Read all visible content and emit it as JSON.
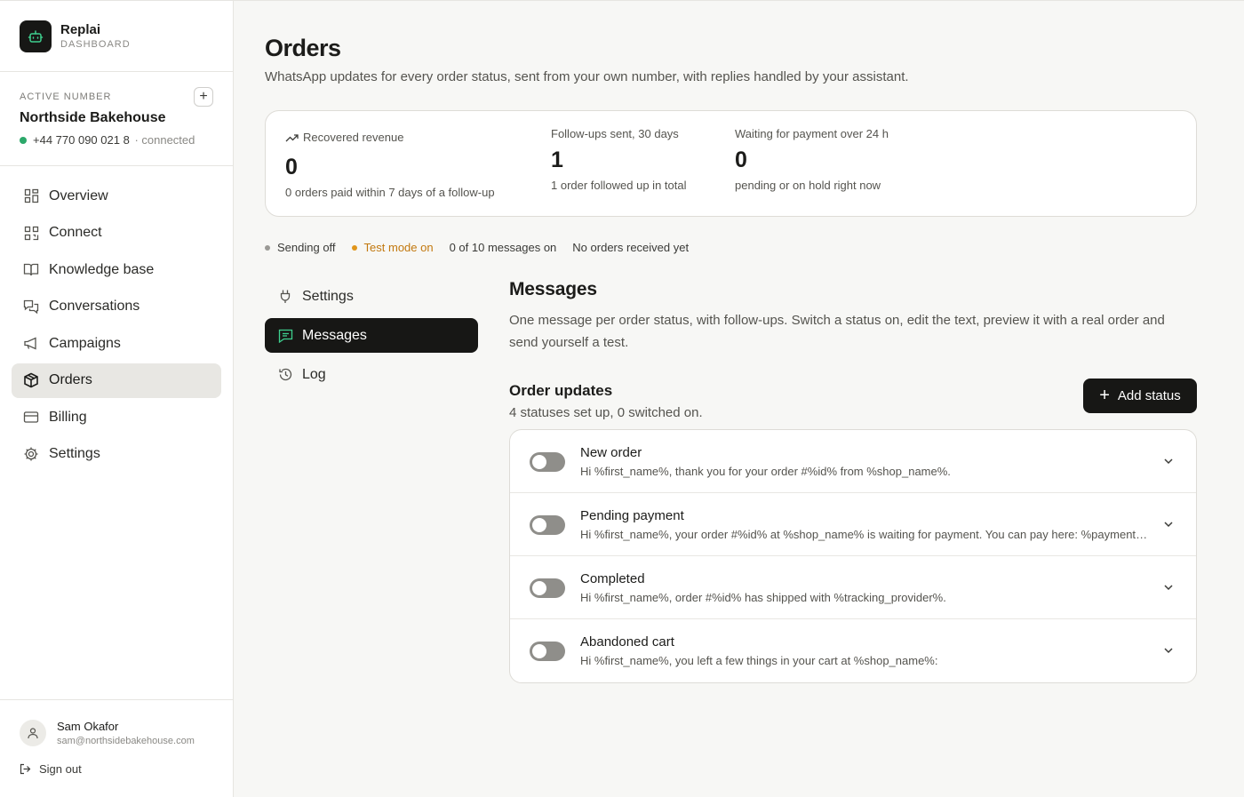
{
  "brand": {
    "name": "Replai",
    "sub": "DASHBOARD"
  },
  "active_number": {
    "label": "ACTIVE NUMBER",
    "add_label": "+",
    "name": "Northside Bakehouse",
    "phone": "+44 770 090 021 8",
    "status": "· connected"
  },
  "nav": {
    "items": [
      {
        "label": "Overview",
        "icon": "grid-icon"
      },
      {
        "label": "Connect",
        "icon": "qr-code-icon"
      },
      {
        "label": "Knowledge base",
        "icon": "book-icon"
      },
      {
        "label": "Conversations",
        "icon": "chat-bubbles-icon"
      },
      {
        "label": "Campaigns",
        "icon": "megaphone-icon"
      },
      {
        "label": "Orders",
        "icon": "box-icon",
        "active": true
      },
      {
        "label": "Billing",
        "icon": "credit-card-icon"
      },
      {
        "label": "Settings",
        "icon": "gear-icon"
      }
    ]
  },
  "user": {
    "name": "Sam Okafor",
    "email": "sam@northsidebakehouse.com",
    "signout": "Sign out"
  },
  "page": {
    "title": "Orders",
    "subtitle": "WhatsApp updates for every order status, sent from your own number, with replies handled by your assistant."
  },
  "stats": [
    {
      "label": "Recovered revenue",
      "value": "0",
      "note": "0 orders paid within 7 days of a follow-up"
    },
    {
      "label": "Follow-ups sent, 30 days",
      "value": "1",
      "note": "1 order followed up in total"
    },
    {
      "label": "Waiting for payment over 24 h",
      "value": "0",
      "note": "pending or on hold right now"
    }
  ],
  "status_bar": {
    "sending": "Sending off",
    "test_mode": "Test mode on",
    "messages_on": "0 of 10 messages on",
    "orders": "No orders received yet"
  },
  "subnav": {
    "items": [
      {
        "label": "Settings",
        "icon": "plug-icon"
      },
      {
        "label": "Messages",
        "icon": "message-square-icon",
        "active": true
      },
      {
        "label": "Log",
        "icon": "history-icon"
      }
    ]
  },
  "messages": {
    "title": "Messages",
    "description": "One message per order status, with follow-ups. Switch a status on, edit the text, preview it with a real order and send yourself a test."
  },
  "order_updates": {
    "title": "Order updates",
    "subtitle": "4 statuses set up, 0 switched on.",
    "add_button": "Add status",
    "rows": [
      {
        "title": "New order",
        "message": "Hi %first_name%, thank you for your order #%id% from %shop_name%.",
        "enabled": false
      },
      {
        "title": "Pending payment",
        "message": "Hi %first_name%, your order #%id% at %shop_name% is waiting for payment. You can pay here: %payment_url%",
        "enabled": false
      },
      {
        "title": "Completed",
        "message": "Hi %first_name%, order #%id% has shipped with %tracking_provider%.",
        "enabled": false
      },
      {
        "title": "Abandoned cart",
        "message": "Hi %first_name%, you left a few things in your cart at %shop_name%:",
        "enabled": false
      }
    ]
  },
  "colors": {
    "accent_dark": "#171715",
    "connected": "#2ca86a",
    "warning": "#c2780e",
    "muted_dot": "#9a9995"
  }
}
